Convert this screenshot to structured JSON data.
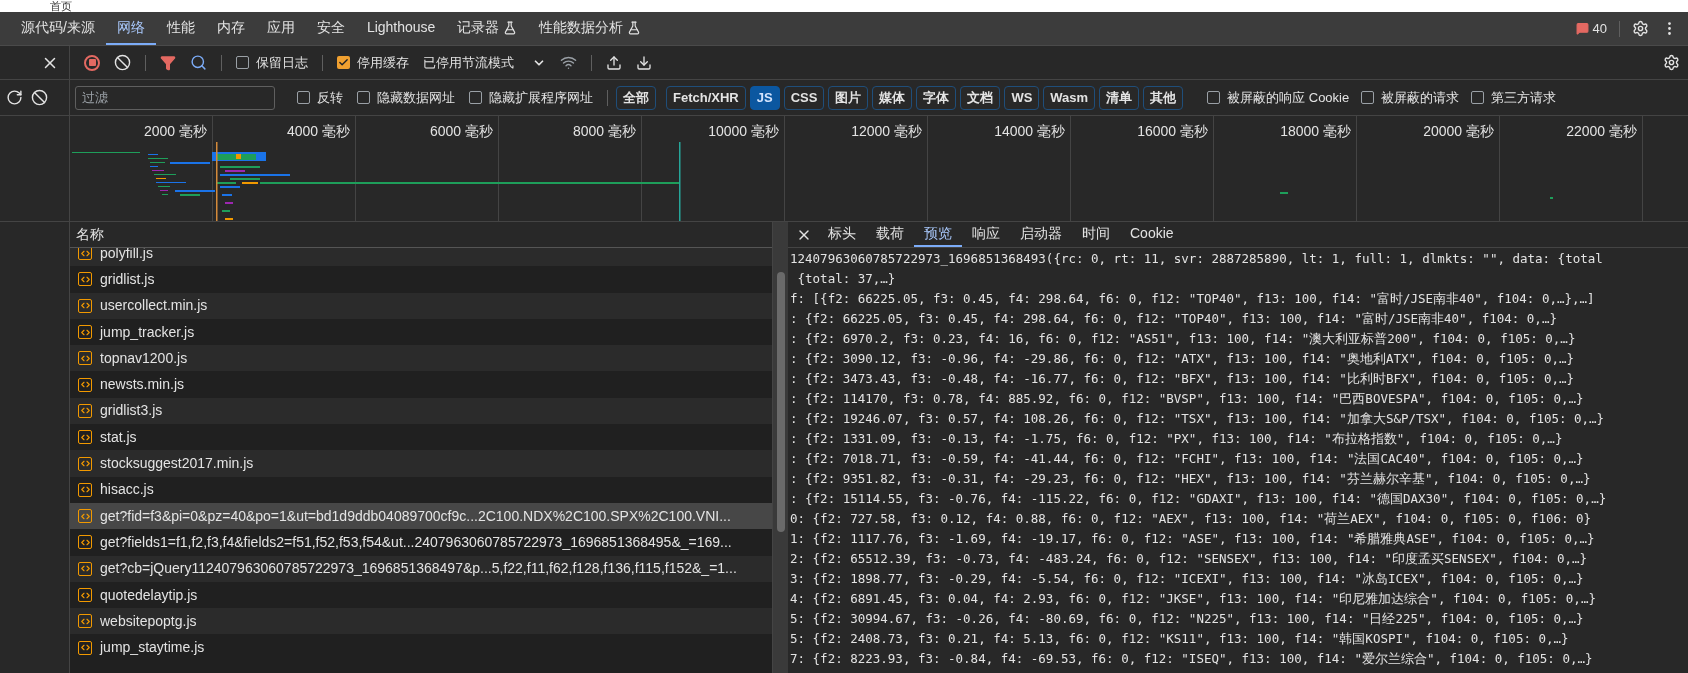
{
  "page_behind": {
    "link": "首页"
  },
  "tabs": [
    {
      "label": "源代码/来源",
      "selected": false,
      "experimental": false
    },
    {
      "label": "网络",
      "selected": true,
      "experimental": false
    },
    {
      "label": "性能",
      "selected": false,
      "experimental": false
    },
    {
      "label": "内存",
      "selected": false,
      "experimental": false
    },
    {
      "label": "应用",
      "selected": false,
      "experimental": false
    },
    {
      "label": "安全",
      "selected": false,
      "experimental": false
    },
    {
      "label": "Lighthouse",
      "selected": false,
      "experimental": false
    },
    {
      "label": "记录器",
      "selected": false,
      "experimental": true
    },
    {
      "label": "性能数据分析",
      "selected": false,
      "experimental": true
    }
  ],
  "issues_badge": "40",
  "toolbar": {
    "recording": true,
    "filter_active": true,
    "preserve_log": {
      "label": "保留日志",
      "checked": false
    },
    "disable_cache": {
      "label": "停用缓存",
      "checked": true
    },
    "throttling": "已停用节流模式"
  },
  "filter": {
    "placeholder": "过滤",
    "options": [
      {
        "label": "反转",
        "checked": false
      },
      {
        "label": "隐藏数据网址",
        "checked": false
      },
      {
        "label": "隐藏扩展程序网址",
        "checked": false
      }
    ],
    "types": [
      {
        "label": "全部",
        "selected": false
      },
      {
        "label": "Fetch/XHR",
        "selected": false
      },
      {
        "label": "JS",
        "selected": true
      },
      {
        "label": "CSS",
        "selected": false
      },
      {
        "label": "图片",
        "selected": false
      },
      {
        "label": "媒体",
        "selected": false
      },
      {
        "label": "字体",
        "selected": false
      },
      {
        "label": "文档",
        "selected": false
      },
      {
        "label": "WS",
        "selected": false
      },
      {
        "label": "Wasm",
        "selected": false
      },
      {
        "label": "清单",
        "selected": false
      },
      {
        "label": "其他",
        "selected": false
      }
    ],
    "extra_options": [
      {
        "label": "被屏蔽的响应 Cookie",
        "checked": false
      },
      {
        "label": "被屏蔽的请求",
        "checked": false
      },
      {
        "label": "第三方请求",
        "checked": false
      }
    ]
  },
  "timeline": {
    "ticks": [
      "2000 毫秒",
      "4000 毫秒",
      "6000 毫秒",
      "8000 毫秒",
      "10000 毫秒",
      "12000 毫秒",
      "14000 毫秒",
      "16000 毫秒",
      "18000 毫秒",
      "20000 毫秒",
      "22000 毫秒"
    ]
  },
  "requests": {
    "column": "名称",
    "rows": [
      {
        "name": "polyfill.js",
        "selected": false
      },
      {
        "name": "gridlist.js",
        "selected": false
      },
      {
        "name": "usercollect.min.js",
        "selected": false
      },
      {
        "name": "jump_tracker.js",
        "selected": false
      },
      {
        "name": "topnav1200.js",
        "selected": false
      },
      {
        "name": "newsts.min.js",
        "selected": false
      },
      {
        "name": "gridlist3.js",
        "selected": false
      },
      {
        "name": "stat.js",
        "selected": false
      },
      {
        "name": "stocksuggest2017.min.js",
        "selected": false
      },
      {
        "name": "hisacc.js",
        "selected": false
      },
      {
        "name": "get?fid=f3&pi=0&pz=40&po=1&ut=bd1d9ddb04089700cf9c...2C100.NDX%2C100.SPX%2C100.VNI...",
        "selected": true
      },
      {
        "name": "get?fields1=f1,f2,f3,f4&fields2=f51,f52,f53,f54&ut...2407963060785722973_1696851368495&_=169...",
        "selected": false
      },
      {
        "name": "get?cb=jQuery112407963060785722973_1696851368497&p...5,f22,f11,f62,f128,f136,f115,f152&_=1...",
        "selected": false
      },
      {
        "name": "quotedelaytip.js",
        "selected": false
      },
      {
        "name": "websitepoptg.js",
        "selected": false
      },
      {
        "name": "jump_staytime.js",
        "selected": false
      }
    ]
  },
  "details": {
    "tabs": [
      {
        "label": "标头",
        "selected": false
      },
      {
        "label": "载荷",
        "selected": false
      },
      {
        "label": "预览",
        "selected": true
      },
      {
        "label": "响应",
        "selected": false
      },
      {
        "label": "启动器",
        "selected": false
      },
      {
        "label": "时间",
        "selected": false
      },
      {
        "label": "Cookie",
        "selected": false
      }
    ],
    "preview_lines": [
      "12407963060785722973_1696851368493({rc: 0, rt: 11, svr: 2887285890, lt: 1, full: 1, dlmkts: \"\", data: {total",
      " {total: 37,…}",
      "f: [{f2: 66225.05, f3: 0.45, f4: 298.64, f6: 0, f12: \"TOP40\", f13: 100, f14: \"富时/JSE南非40\", f104: 0,…},…]",
      ": {f2: 66225.05, f3: 0.45, f4: 298.64, f6: 0, f12: \"TOP40\", f13: 100, f14: \"富时/JSE南非40\", f104: 0,…}",
      ": {f2: 6970.2, f3: 0.23, f4: 16, f6: 0, f12: \"AS51\", f13: 100, f14: \"澳大利亚标普200\", f104: 0, f105: 0,…}",
      ": {f2: 3090.12, f3: -0.96, f4: -29.86, f6: 0, f12: \"ATX\", f13: 100, f14: \"奥地利ATX\", f104: 0, f105: 0,…}",
      ": {f2: 3473.43, f3: -0.48, f4: -16.77, f6: 0, f12: \"BFX\", f13: 100, f14: \"比利时BFX\", f104: 0, f105: 0,…}",
      ": {f2: 114170, f3: 0.78, f4: 885.92, f6: 0, f12: \"BVSP\", f13: 100, f14: \"巴西BOVESPA\", f104: 0, f105: 0,…}",
      ": {f2: 19246.07, f3: 0.57, f4: 108.26, f6: 0, f12: \"TSX\", f13: 100, f14: \"加拿大S&P/TSX\", f104: 0, f105: 0,…}",
      ": {f2: 1331.09, f3: -0.13, f4: -1.75, f6: 0, f12: \"PX\", f13: 100, f14: \"布拉格指数\", f104: 0, f105: 0,…}",
      ": {f2: 7018.71, f3: -0.59, f4: -41.44, f6: 0, f12: \"FCHI\", f13: 100, f14: \"法国CAC40\", f104: 0, f105: 0,…}",
      ": {f2: 9351.82, f3: -0.31, f4: -29.23, f6: 0, f12: \"HEX\", f13: 100, f14: \"芬兰赫尔辛基\", f104: 0, f105: 0,…}",
      ": {f2: 15114.55, f3: -0.76, f4: -115.22, f6: 0, f12: \"GDAXI\", f13: 100, f14: \"德国DAX30\", f104: 0, f105: 0,…}",
      "0: {f2: 727.58, f3: 0.12, f4: 0.88, f6: 0, f12: \"AEX\", f13: 100, f14: \"荷兰AEX\", f104: 0, f105: 0, f106: 0}",
      "1: {f2: 1117.76, f3: -1.69, f4: -19.17, f6: 0, f12: \"ASE\", f13: 100, f14: \"希腊雅典ASE\", f104: 0, f105: 0,…}",
      "2: {f2: 65512.39, f3: -0.73, f4: -483.24, f6: 0, f12: \"SENSEX\", f13: 100, f14: \"印度孟买SENSEX\", f104: 0,…}",
      "3: {f2: 1898.77, f3: -0.29, f4: -5.54, f6: 0, f12: \"ICEXI\", f13: 100, f14: \"冰岛ICEX\", f104: 0, f105: 0,…}",
      "4: {f2: 6891.45, f3: 0.04, f4: 2.93, f6: 0, f12: \"JKSE\", f13: 100, f14: \"印尼雅加达综合\", f104: 0, f105: 0,…}",
      "5: {f2: 30994.67, f3: -0.26, f4: -80.69, f6: 0, f12: \"N225\", f13: 100, f14: \"日经225\", f104: 0, f105: 0,…}",
      "5: {f2: 2408.73, f3: 0.21, f4: 5.13, f6: 0, f12: \"KS11\", f13: 100, f14: \"韩国KOSPI\", f104: 0, f105: 0,…}",
      "7: {f2: 8223.93, f3: -0.84, f4: -69.53, f6: 0, f12: \"ISEQ\", f13: 100, f14: \"爱尔兰综合\", f104: 0, f105: 0,…}"
    ]
  }
}
